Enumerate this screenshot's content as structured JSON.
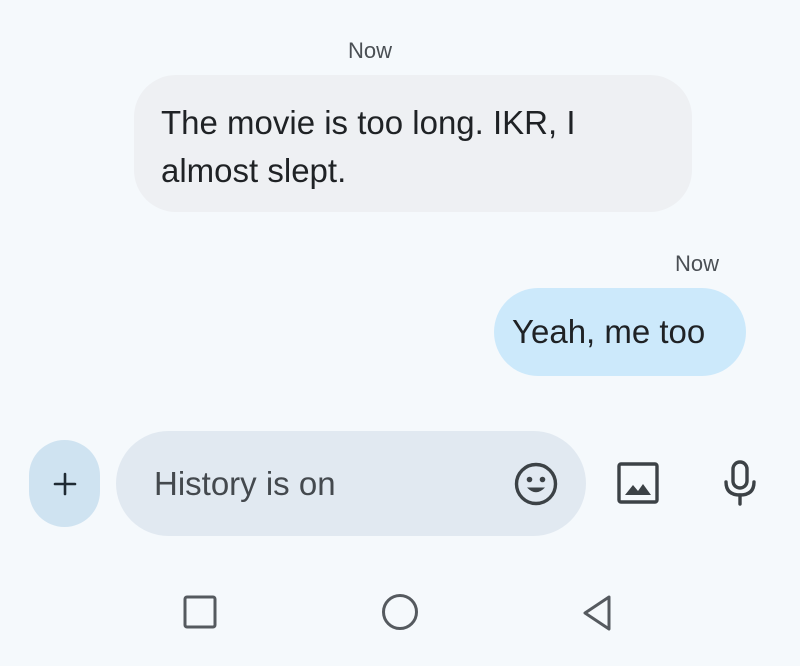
{
  "messages": [
    {
      "timestamp": "Now",
      "direction": "incoming",
      "text": "The movie is too long. IKR, I almost slept."
    },
    {
      "timestamp": "Now",
      "direction": "outgoing",
      "text": "Yeah, me too"
    }
  ],
  "composer": {
    "plus_icon": "plus-icon",
    "placeholder": "History is on",
    "emoji_icon": "emoji-icon",
    "image_icon": "image-icon",
    "mic_icon": "mic-icon"
  },
  "navbar": {
    "recents_icon": "square-icon",
    "home_icon": "circle-icon",
    "back_icon": "triangle-back-icon"
  },
  "colors": {
    "background": "#f5f9fc",
    "incoming_bubble": "#eef0f3",
    "outgoing_bubble": "#cce9fb",
    "compose_field": "#e1e9f1",
    "plus_button": "#cfe3f1",
    "icon": "#3c4246"
  }
}
